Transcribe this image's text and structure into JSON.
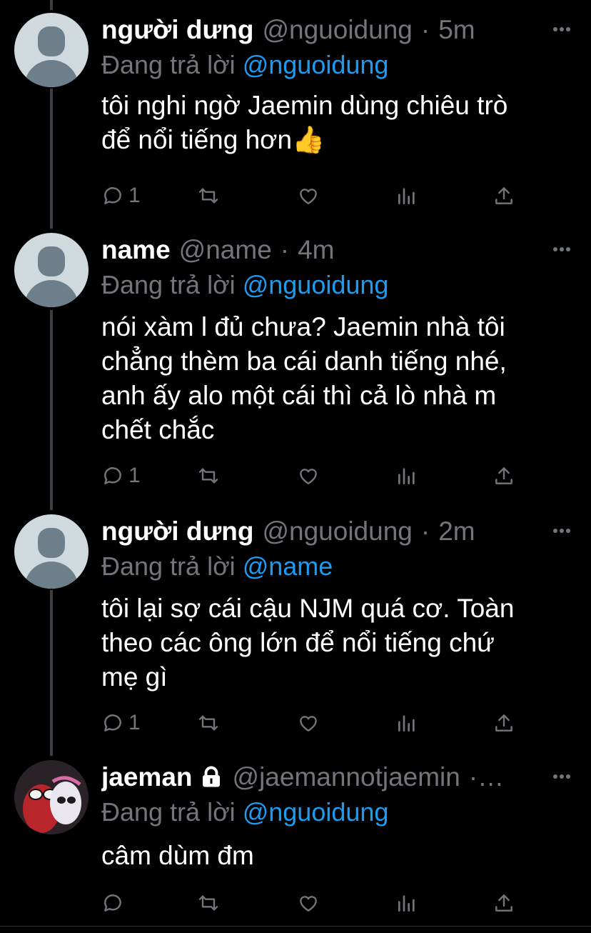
{
  "reply_prefix": "Đang trả lời",
  "tweets": [
    {
      "name": "người dưng",
      "handle": "@nguoidung",
      "dot": "·",
      "time": "5m",
      "reply_to": "@nguoidung",
      "text": [
        "tôi nghi ngờ Jaemin dùng chiêu trò",
        "để nổi tiếng hơn👍"
      ],
      "replies": "1"
    },
    {
      "name": "name",
      "handle": "@name",
      "dot": "·",
      "time": "4m",
      "reply_to": "@nguoidung",
      "text": [
        "nói xàm l đủ chưa? Jaemin nhà tôi",
        "chẳng thèm ba cái danh tiếng nhé,",
        "anh ấy alo một cái thì cả lò nhà m",
        "chết chắc"
      ],
      "replies": "1"
    },
    {
      "name": "người dưng",
      "handle": "@nguoidung",
      "dot": "·",
      "time": "2m",
      "reply_to": "@name",
      "text": [
        "tôi lại sợ cái cậu NJM quá cơ. Toàn",
        "theo các ông lớn để nổi tiếng chứ",
        "mẹ gì"
      ],
      "replies": "1"
    },
    {
      "name": "jaeman",
      "handle": "@jaemannotjaemin",
      "dot": "·…",
      "time": "",
      "reply_to": "@nguoidung",
      "text": [
        "câm dùm đm"
      ],
      "replies": ""
    }
  ],
  "colors": {
    "background": "#000000",
    "accent": "#1d9bf0",
    "muted": "#71767b",
    "text": "#ffffff"
  },
  "icons": [
    "reply-icon",
    "retweet-icon",
    "like-icon",
    "views-icon",
    "share-icon",
    "more-icon",
    "lock-icon"
  ]
}
